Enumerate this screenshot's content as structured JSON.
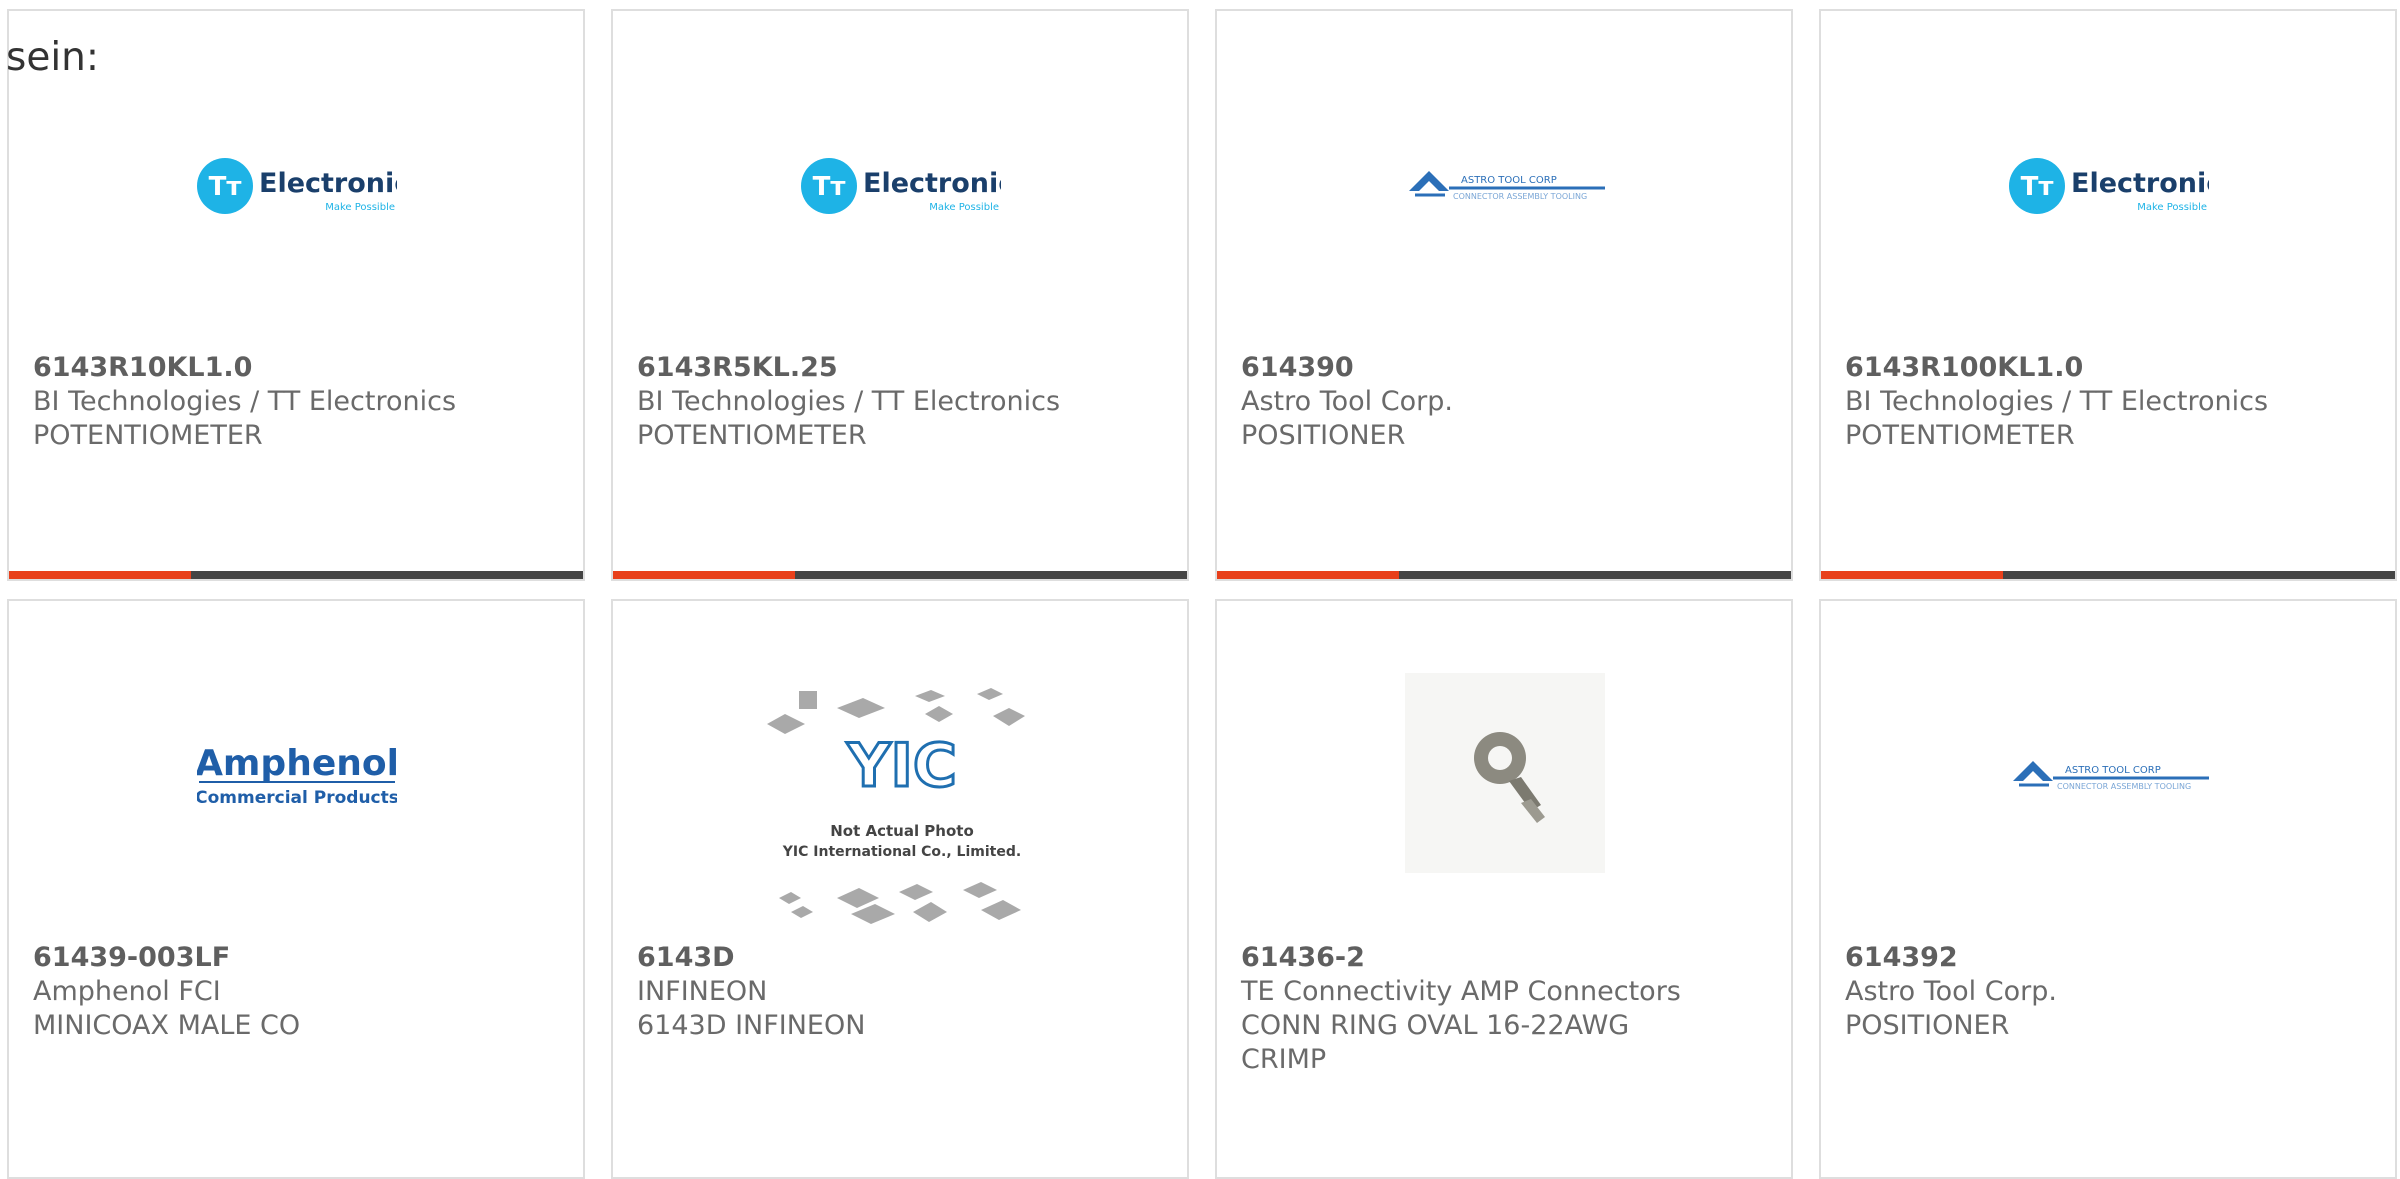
{
  "page": {
    "intro_text": "sein:"
  },
  "colors": {
    "accent": "#e8401b",
    "bar": "#444444",
    "tt_blue": "#1eb3e6",
    "amphenol_blue": "#1f5ea8",
    "astro_blue": "#2b6fb8"
  },
  "products": [
    {
      "part_number": "6143R10KL1.0",
      "manufacturer": "BI Technologies / TT Electronics",
      "description": "POTENTIOMETER",
      "logo": "tt-electronics-logo",
      "logo_text": "Electronics",
      "logo_sub": "Make Possible"
    },
    {
      "part_number": "6143R5KL.25",
      "manufacturer": "BI Technologies / TT Electronics",
      "description": "POTENTIOMETER",
      "logo": "tt-electronics-logo",
      "logo_text": "Electronics",
      "logo_sub": "Make Possible"
    },
    {
      "part_number": "614390",
      "manufacturer": "Astro Tool Corp.",
      "description": "POSITIONER",
      "logo": "astro-tool-logo",
      "logo_text": "ASTRO TOOL CORP",
      "logo_sub": "CONNECTOR ASSEMBLY TOOLING"
    },
    {
      "part_number": "6143R100KL1.0",
      "manufacturer": "BI Technologies / TT Electronics",
      "description": "POTENTIOMETER",
      "logo": "tt-electronics-logo",
      "logo_text": "Electronics",
      "logo_sub": "Make Possible"
    },
    {
      "part_number": "61439-003LF",
      "manufacturer": "Amphenol FCI",
      "description": "MINICOAX MALE CO",
      "logo": "amphenol-logo",
      "logo_text": "Amphenol",
      "logo_sub": "Commercial Products"
    },
    {
      "part_number": "6143D",
      "manufacturer": "INFINEON",
      "description": "6143D INFINEON",
      "logo": "yic-placeholder-image",
      "logo_text": "Not Actual Photo",
      "logo_sub": "YIC International Co., Limited."
    },
    {
      "part_number": "61436-2",
      "manufacturer": "TE Connectivity AMP Connectors",
      "description": "CONN RING OVAL 16-22AWG",
      "description_2": "CRIMP",
      "logo": "ring-terminal-photo"
    },
    {
      "part_number": "614392",
      "manufacturer": "Astro Tool Corp.",
      "description": "POSITIONER",
      "logo": "astro-tool-logo",
      "logo_text": "ASTRO TOOL CORP",
      "logo_sub": "CONNECTOR ASSEMBLY TOOLING"
    }
  ]
}
